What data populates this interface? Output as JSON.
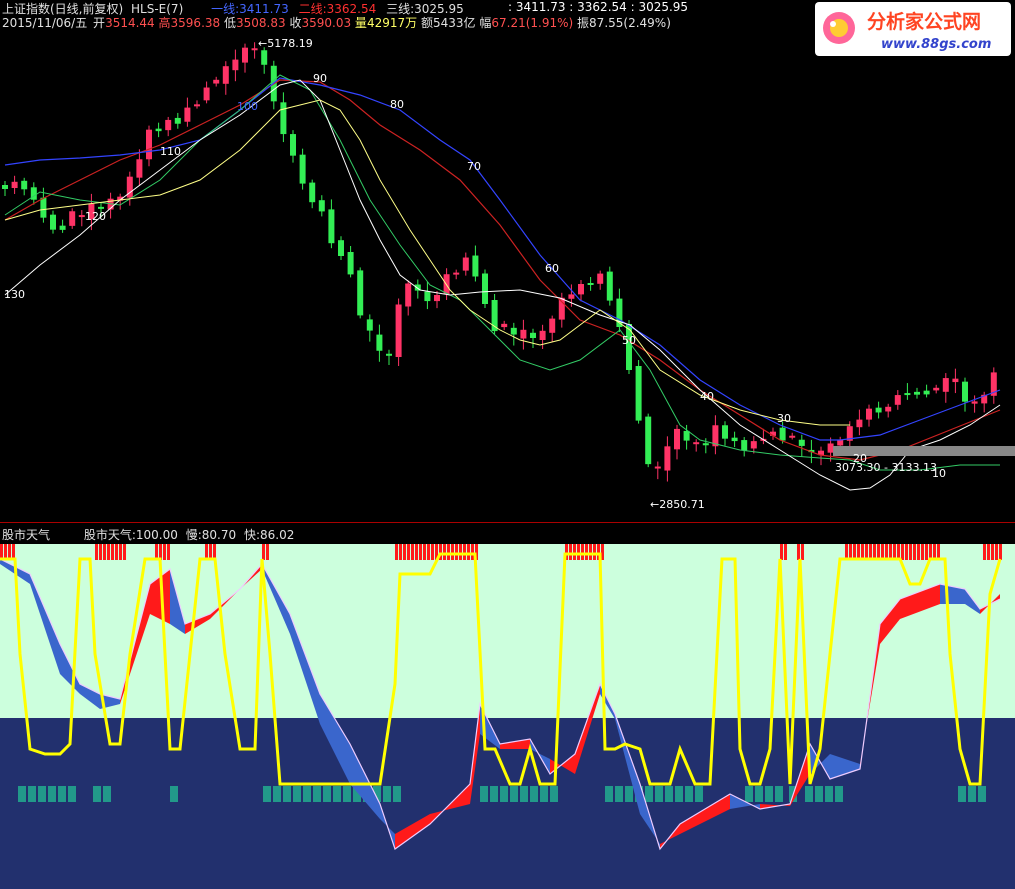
{
  "header": {
    "index_name": "上证指数(日线,前复权)",
    "indicator_name": "HLS-E(7)",
    "line1_label": "一线:",
    "line1_value": "3411.73",
    "line2_label": "二线:",
    "line2_value": "3362.54",
    "line3_label": "三线:",
    "line3_value": "3025.95",
    "right_readout": ": 3411.73 : 3362.54 : 3025.95",
    "date": "2015/11/06/五",
    "open_label": "开",
    "open": "3514.44",
    "high_label": "高",
    "high": "3596.38",
    "low_label": "低",
    "low": "3508.83",
    "close_label": "收",
    "close": "3590.03",
    "vol_label": "量",
    "vol": "42917万",
    "amount_label": "额",
    "amount": "5433亿",
    "chg_label": "幅",
    "chg": "67.21(1.91%)",
    "amp_label": "振",
    "amp": "87.55(2.49%)"
  },
  "logo": {
    "title": "分析家公式网",
    "url": "www.88gs.com"
  },
  "main_chart": {
    "high_marker": "5178.19",
    "low_marker": "2850.71",
    "range_marker": "3073.30 - 3133.13",
    "curve_labels": [
      "130",
      "120",
      "110",
      "100",
      "90",
      "80",
      "70",
      "60",
      "50",
      "40",
      "30",
      "20",
      "10"
    ]
  },
  "sub_chart": {
    "title": "股市天气",
    "readout_label": "股市天气:",
    "readout_value": "100.00",
    "slow_label": "慢:",
    "slow_value": "80.70",
    "fast_label": "快:",
    "fast_value": "86.02"
  },
  "colors": {
    "up": "#ff3366",
    "down": "#33ee55",
    "line1": "#3344ff",
    "line2": "#ff2222",
    "line3": "#ffffff",
    "weather": "#ffff00",
    "band_red": "#ff1a1a",
    "band_blue": "#3a66cc",
    "light_bg": "#ccffdd",
    "dark_bg": "#22306e"
  }
}
